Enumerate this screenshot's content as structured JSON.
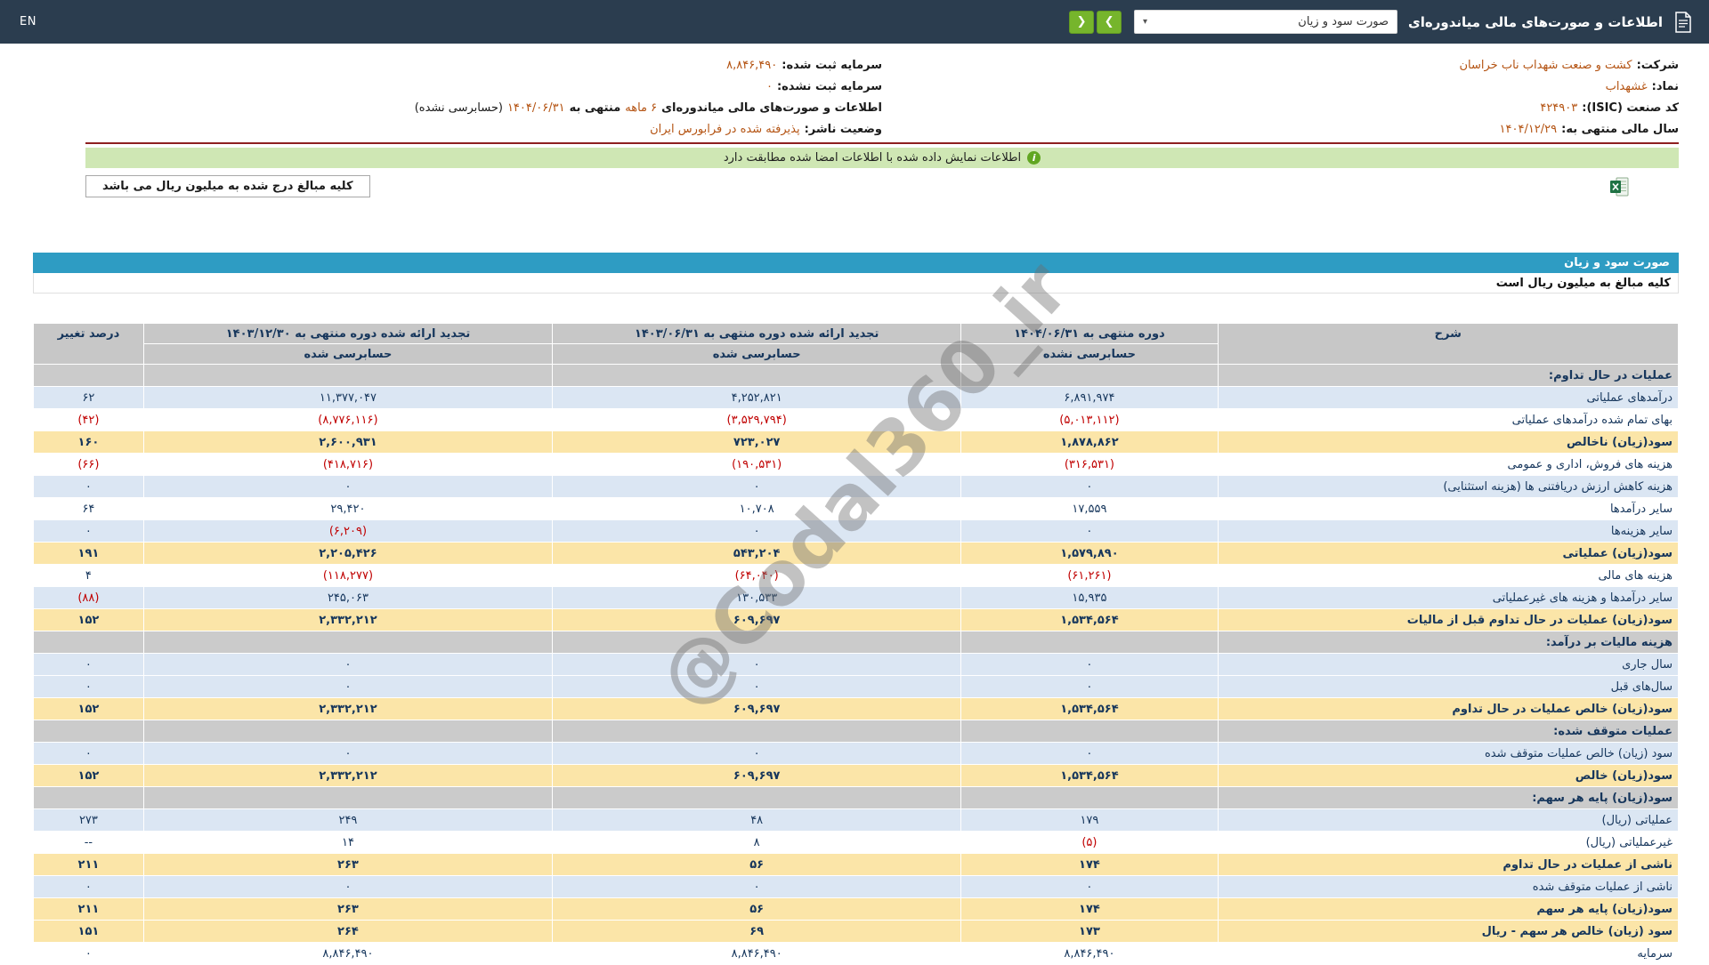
{
  "page": {
    "watermark": "@Codal360_ir"
  },
  "colors": {
    "topbar_bg": "#2b3d4f",
    "nav_button_green": "#76b52c",
    "statement_bar_teal": "#2e9cc3",
    "banner_green_bg": "#cfe7b4",
    "maroon_line": "#8e1f1f",
    "row_blue": "#dbe6f3",
    "row_yellow": "#fbe5a8",
    "section_gray": "#cbcbcb",
    "header_gray": "#c7c7c7",
    "value_navy": "#16365c",
    "negative_red": "#c00000",
    "emphasis_orange": "#b45312"
  },
  "icons": {
    "dropdown_caret": "▾",
    "info_letter": "i"
  },
  "topbar": {
    "title": "اطلاعات و صورت‌های مالی میاندوره‌ای",
    "statement_dropdown": {
      "selected": "صورت سود و زیان"
    },
    "nav": {
      "next_icon": "❯",
      "prev_icon": "❮"
    },
    "language_link": "EN"
  },
  "company_info": {
    "right": [
      {
        "label": "شرکت:",
        "value": "کشت و صنعت شهداب ناب خراسان"
      },
      {
        "label": "نماد:",
        "value": "غشهداب"
      },
      {
        "label": "کد صنعت (ISIC):",
        "value": "۴۲۴۹۰۳"
      },
      {
        "label": "سال مالی منتهی به:",
        "value": "۱۴۰۴/۱۲/۲۹"
      }
    ],
    "left": [
      {
        "label": "سرمایه ثبت شده:",
        "value": "۸,۸۴۶,۴۹۰"
      },
      {
        "label": "سرمایه ثبت نشده:",
        "value": "۰"
      }
    ],
    "period_line": {
      "prefix": "اطلاعات و صورت‌های مالی میاندوره‌ای",
      "duration": "۶ ماهه",
      "middle": "منتهی به",
      "date": "۱۴۰۴/۰۶/۳۱",
      "suffix": "(حسابرسی نشده)"
    },
    "status": {
      "label": "وضعیت ناشر:",
      "value": "پذیرفته شده در فرابورس ایران"
    }
  },
  "notices": {
    "signature_match": "اطلاعات نمایش داده شده با اطلاعات امضا شده مطابقت دارد",
    "amounts_note": "کلیه مبالغ درج شده به میلیون ریال می باشد"
  },
  "statement": {
    "title": "صورت سود و زیان",
    "units_note": "کلیه مبالغ به میلیون ریال است"
  },
  "table": {
    "headers": {
      "description": "شرح",
      "col1_title": "دوره منتهی به ۱۴۰۴/۰۶/۳۱",
      "col1_sub": "حسابرسی نشده",
      "col2_title": "تجدید ارائه شده دوره منتهی به ۱۴۰۳/۰۶/۳۱",
      "col2_sub": "حسابرسی شده",
      "col3_title": "تجدید ارائه شده دوره منتهی به ۱۴۰۳/۱۲/۳۰",
      "col3_sub": "حسابرسی شده",
      "change": "درصد تغییر"
    },
    "rows": [
      {
        "label": "عملیات در حال تداوم:",
        "v1": "",
        "v2": "",
        "v3": "",
        "chg": "",
        "style": "section"
      },
      {
        "label": "درآمدهای عملیاتی",
        "v1": "۶,۸۹۱,۹۷۴",
        "v2": "۴,۲۵۲,۸۲۱",
        "v3": "۱۱,۳۷۷,۰۴۷",
        "chg": "۶۲",
        "style": "blue"
      },
      {
        "label": "بهای تمام شده درآمدهای عملیاتی",
        "v1": "(۵,۰۱۳,۱۱۲)",
        "v2": "(۳,۵۲۹,۷۹۴)",
        "v3": "(۸,۷۷۶,۱۱۶)",
        "chg": "(۴۲)",
        "style": "white"
      },
      {
        "label": "سود(زیان) ناخالص",
        "v1": "۱,۸۷۸,۸۶۲",
        "v2": "۷۲۳,۰۲۷",
        "v3": "۲,۶۰۰,۹۳۱",
        "chg": "۱۶۰",
        "style": "yellow"
      },
      {
        "label": "هزینه های فروش، اداری و عمومی",
        "v1": "(۳۱۶,۵۳۱)",
        "v2": "(۱۹۰,۵۳۱)",
        "v3": "(۴۱۸,۷۱۶)",
        "chg": "(۶۶)",
        "style": "white"
      },
      {
        "label": "هزینه کاهش ارزش دریافتنی ها (هزینه استثنایی)",
        "v1": "۰",
        "v2": "۰",
        "v3": "۰",
        "chg": "۰",
        "style": "blue"
      },
      {
        "label": "سایر درآمدها",
        "v1": "۱۷,۵۵۹",
        "v2": "۱۰,۷۰۸",
        "v3": "۲۹,۴۲۰",
        "chg": "۶۴",
        "style": "white"
      },
      {
        "label": "سایر هزینه‌ها",
        "v1": "۰",
        "v2": "۰",
        "v3": "(۶,۲۰۹)",
        "chg": "۰",
        "style": "blue"
      },
      {
        "label": "سود(زیان) عملیاتی",
        "v1": "۱,۵۷۹,۸۹۰",
        "v2": "۵۴۳,۲۰۴",
        "v3": "۲,۲۰۵,۴۲۶",
        "chg": "۱۹۱",
        "style": "yellow"
      },
      {
        "label": "هزینه های مالی",
        "v1": "(۶۱,۲۶۱)",
        "v2": "(۶۴,۰۴۰)",
        "v3": "(۱۱۸,۲۷۷)",
        "chg": "۴",
        "style": "white"
      },
      {
        "label": "سایر درآمدها و هزینه های غیرعملیاتی",
        "v1": "۱۵,۹۳۵",
        "v2": "۱۳۰,۵۳۳",
        "v3": "۲۴۵,۰۶۳",
        "chg": "(۸۸)",
        "style": "blue"
      },
      {
        "label": "سود(زیان) عملیات در حال تداوم قبل از مالیات",
        "v1": "۱,۵۳۴,۵۶۴",
        "v2": "۶۰۹,۶۹۷",
        "v3": "۲,۳۳۲,۲۱۲",
        "chg": "۱۵۲",
        "style": "yellow"
      },
      {
        "label": "هزینه مالیات بر درآمد:",
        "v1": "",
        "v2": "",
        "v3": "",
        "chg": "",
        "style": "section"
      },
      {
        "label": "سال جاری",
        "v1": "۰",
        "v2": "۰",
        "v3": "۰",
        "chg": "۰",
        "style": "blue"
      },
      {
        "label": "سال‌های قبل",
        "v1": "۰",
        "v2": "۰",
        "v3": "۰",
        "chg": "۰",
        "style": "blue"
      },
      {
        "label": "سود(زیان) خالص عملیات در حال تداوم",
        "v1": "۱,۵۳۴,۵۶۴",
        "v2": "۶۰۹,۶۹۷",
        "v3": "۲,۳۳۲,۲۱۲",
        "chg": "۱۵۲",
        "style": "yellow"
      },
      {
        "label": "عملیات متوقف شده:",
        "v1": "",
        "v2": "",
        "v3": "",
        "chg": "",
        "style": "section"
      },
      {
        "label": "سود (زیان) خالص عملیات متوقف شده",
        "v1": "۰",
        "v2": "۰",
        "v3": "۰",
        "chg": "۰",
        "style": "blue"
      },
      {
        "label": "سود(زیان) خالص",
        "v1": "۱,۵۳۴,۵۶۴",
        "v2": "۶۰۹,۶۹۷",
        "v3": "۲,۳۳۲,۲۱۲",
        "chg": "۱۵۲",
        "style": "yellow"
      },
      {
        "label": "سود(زیان) پایه هر سهم:",
        "v1": "",
        "v2": "",
        "v3": "",
        "chg": "",
        "style": "section"
      },
      {
        "label": "عملیاتی (ریال)",
        "v1": "۱۷۹",
        "v2": "۴۸",
        "v3": "۲۴۹",
        "chg": "۲۷۳",
        "style": "blue"
      },
      {
        "label": "غیرعملیاتی (ریال)",
        "v1": "(۵)",
        "v2": "۸",
        "v3": "۱۴",
        "chg": "--",
        "style": "white"
      },
      {
        "label": "ناشی از عملیات در حال تداوم",
        "v1": "۱۷۴",
        "v2": "۵۶",
        "v3": "۲۶۳",
        "chg": "۲۱۱",
        "style": "yellow"
      },
      {
        "label": "ناشی از عملیات متوقف شده",
        "v1": "۰",
        "v2": "۰",
        "v3": "۰",
        "chg": "۰",
        "style": "blue"
      },
      {
        "label": "سود(زیان) پایه هر سهم",
        "v1": "۱۷۴",
        "v2": "۵۶",
        "v3": "۲۶۳",
        "chg": "۲۱۱",
        "style": "yellow"
      },
      {
        "label": "سود (زیان) خالص هر سهم - ریال",
        "v1": "۱۷۳",
        "v2": "۶۹",
        "v3": "۲۶۴",
        "chg": "۱۵۱",
        "style": "yellow"
      },
      {
        "label": "سرمایه",
        "v1": "۸,۸۴۶,۴۹۰",
        "v2": "۸,۸۴۶,۴۹۰",
        "v3": "۸,۸۴۶,۴۹۰",
        "chg": "۰",
        "style": "white"
      }
    ]
  }
}
